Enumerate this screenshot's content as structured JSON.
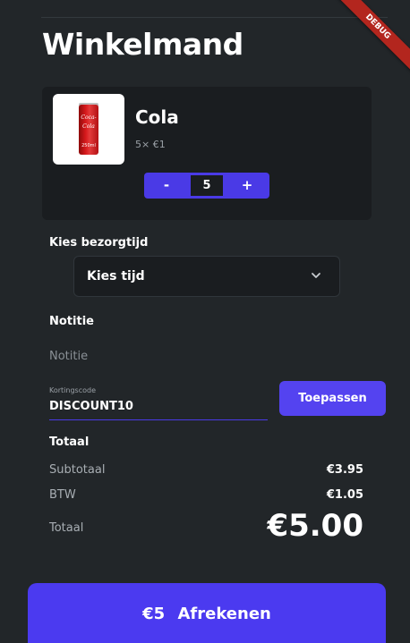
{
  "header": {
    "title": "Winkelmand",
    "debug_badge": "DEBUG"
  },
  "cart": {
    "item": {
      "name": "Cola",
      "qty_price": "5× €1",
      "quantity": "5",
      "minus_label": "-",
      "plus_label": "+",
      "image_brand_text": "Coca-Cola",
      "image_volume_text": "250ml"
    }
  },
  "delivery": {
    "label": "Kies bezorgtijd",
    "select_value": "Kies tijd",
    "icon": "chevron-down-icon"
  },
  "note": {
    "label": "Notitie",
    "placeholder": "Notitie"
  },
  "discount": {
    "label": "Kortingscode",
    "value": "DISCOUNT10",
    "apply_label": "Toepassen"
  },
  "totals": {
    "heading": "Totaal",
    "subtotal_label": "Subtotaal",
    "subtotal_value": "€3.95",
    "tax_label": "BTW",
    "tax_value": "€1.05",
    "total_label": "Totaal",
    "total_value": "€5.00"
  },
  "checkout": {
    "amount": "€5",
    "label": "Afrekenen"
  },
  "colors": {
    "background": "#222629",
    "card": "#1a1d20",
    "accent": "#4b3af0",
    "debug": "#b3261e"
  }
}
